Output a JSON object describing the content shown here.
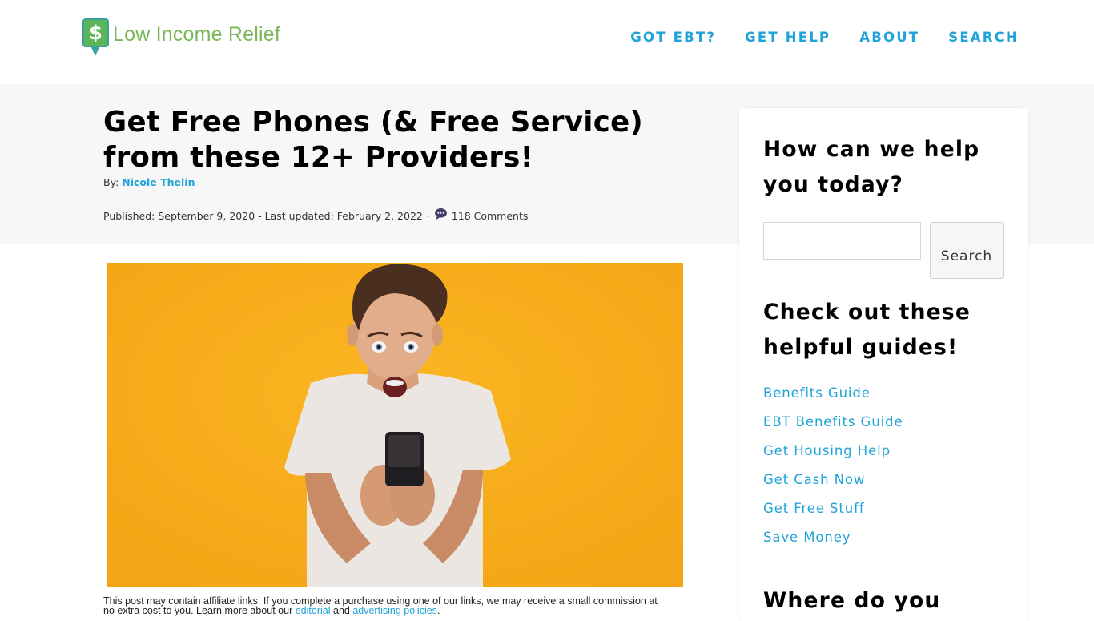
{
  "header": {
    "logo_text": "Low Income Relief",
    "logo_icon": "dollar-chat-bubble-icon",
    "nav": [
      {
        "label": "GOT EBT?"
      },
      {
        "label": "GET HELP"
      },
      {
        "label": "ABOUT"
      },
      {
        "label": "SEARCH"
      }
    ]
  },
  "post": {
    "title": "Get Free Phones (& Free Service) from these 12+ Providers!",
    "byline_prefix": "By:",
    "author": "Nicole Thelin",
    "published_label": "Published: September 9, 2020 - Last updated: February 2, 2022 ·",
    "comments_icon": "comment-bubble-icon",
    "comments_count": "118 Comments",
    "featured_image_alt": "Surprised man in white t-shirt looking at smartphone on orange background",
    "disclaimer": {
      "text_before": "This post may contain affiliate links. If you complete a purchase using one of our links, we may receive a small commission at no extra cost to you. Learn more about our ",
      "link1": "editorial",
      "text_middle": " and ",
      "link2": "advertising policies",
      "text_after": "."
    }
  },
  "sidebar": {
    "search_widget_title": "How can we help you today?",
    "search_input_value": "",
    "search_button_label": "Search",
    "guides_title": "Check out these helpful guides!",
    "guides": [
      {
        "label": "Benefits Guide"
      },
      {
        "label": "EBT Benefits Guide"
      },
      {
        "label": "Get Housing Help"
      },
      {
        "label": "Get Cash Now"
      },
      {
        "label": "Get Free Stuff"
      },
      {
        "label": "Save Money"
      }
    ],
    "next_widget_title": "Where do you"
  },
  "colors": {
    "accent": "#1fa3d8",
    "logo_green": "#7ab65a",
    "hero_band": "#f7f7f7",
    "image_background": "#f9b21c"
  }
}
